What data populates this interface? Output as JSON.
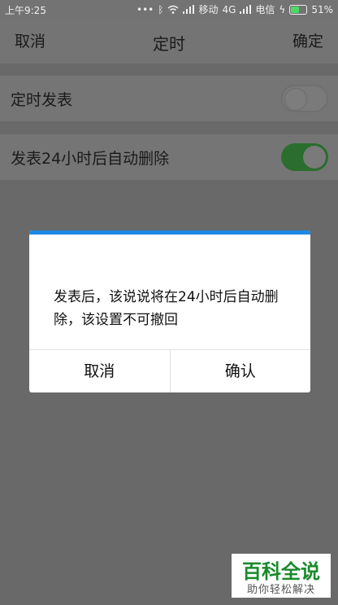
{
  "status_bar": {
    "time": "上午9:25",
    "icons": [
      "dots-icon",
      "bluetooth-icon",
      "wifi-icon",
      "signal-icon"
    ],
    "carrier1": "移动",
    "network": "4G",
    "carrier2": "电信",
    "battery": "51%",
    "battery_level": 0.51
  },
  "header": {
    "cancel_label": "取消",
    "title": "定时",
    "confirm_label": "确定"
  },
  "settings": [
    {
      "label": "定时发表",
      "toggle": "off"
    },
    {
      "label": "发表24小时后自动删除",
      "toggle": "on"
    }
  ],
  "dialog": {
    "message": "发表后，该说说将在24小时后自动删除，该设置不可撤回",
    "cancel_label": "取消",
    "confirm_label": "确认",
    "accent_color": "#1e88e5"
  },
  "watermark": {
    "title": "百科全说",
    "subtitle": "助你轻松解决"
  }
}
